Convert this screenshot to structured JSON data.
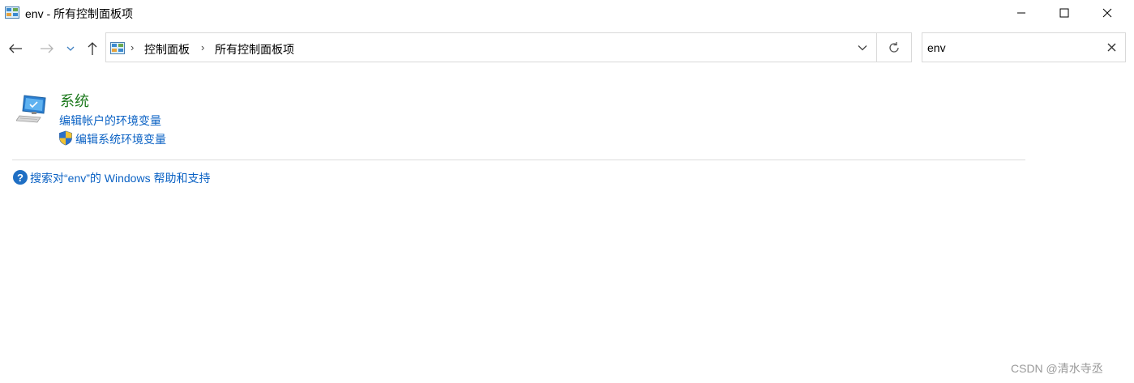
{
  "window": {
    "title": "env - 所有控制面板项",
    "icon": "control-panel-icon"
  },
  "navigation": {
    "back_icon": "arrow-left-icon",
    "forward_icon": "arrow-right-icon",
    "recent_icon": "chevron-down-icon",
    "up_icon": "arrow-up-icon"
  },
  "address_bar": {
    "breadcrumbs": [
      "控制面板",
      "所有控制面板项"
    ],
    "separator": "›"
  },
  "search": {
    "value": "env"
  },
  "results": {
    "title": "系统",
    "links": [
      "编辑帐户的环境变量",
      "编辑系统环境变量"
    ]
  },
  "help_link": "搜索对“env”的 Windows 帮助和支持",
  "watermark": "CSDN @清水寺丞",
  "colors": {
    "title_green": "#1e7a1e",
    "link_blue": "#0b62c4"
  }
}
